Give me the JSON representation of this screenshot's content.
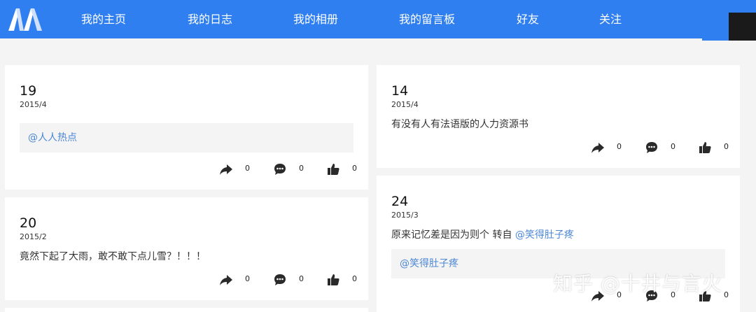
{
  "nav": {
    "items": [
      {
        "label": "我的主页"
      },
      {
        "label": "我的日志"
      },
      {
        "label": "我的相册"
      },
      {
        "label": "我的留言板"
      },
      {
        "label": "好友"
      },
      {
        "label": "关注"
      }
    ]
  },
  "posts": [
    {
      "day": "19",
      "date": "2015/4",
      "quote": "@人人热点",
      "share": "0",
      "comment": "0",
      "like": "0"
    },
    {
      "day": "14",
      "date": "2015/4",
      "text": "有没有人有法语版的人力资源书",
      "share": "0",
      "comment": "0",
      "like": "0"
    },
    {
      "day": "20",
      "date": "2015/2",
      "text": "竟然下起了大雨，敢不敢下点儿雪？！！！",
      "share": "0",
      "comment": "0",
      "like": "0"
    },
    {
      "day": "24",
      "date": "2015/3",
      "text": "原来记忆差是因为则个 转自 ",
      "mention": "@笑得肚子疼",
      "quote": "@笑得肚子疼",
      "share": "0",
      "comment": "0",
      "like": "0"
    }
  ],
  "watermark": "知乎 @十井与言火",
  "colors": {
    "nav_bg": "#2f7ff0",
    "link": "#4a86d6",
    "page_bg": "#f4f4f4"
  }
}
